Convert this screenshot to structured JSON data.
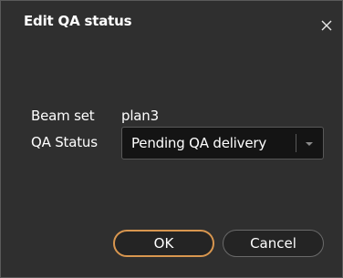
{
  "dialog": {
    "title": "Edit QA status",
    "close_icon": "close-icon"
  },
  "form": {
    "beam_set_label": "Beam set",
    "beam_set_value": "plan3",
    "qa_status_label": "QA Status",
    "qa_status_value": "Pending QA delivery",
    "dropdown_icon": "chevron-down-icon"
  },
  "buttons": {
    "ok_label": "OK",
    "cancel_label": "Cancel"
  },
  "colors": {
    "background": "#2f2f2f",
    "input_background": "#141414",
    "primary_button_border": "#d8964f",
    "text": "#ffffff"
  }
}
